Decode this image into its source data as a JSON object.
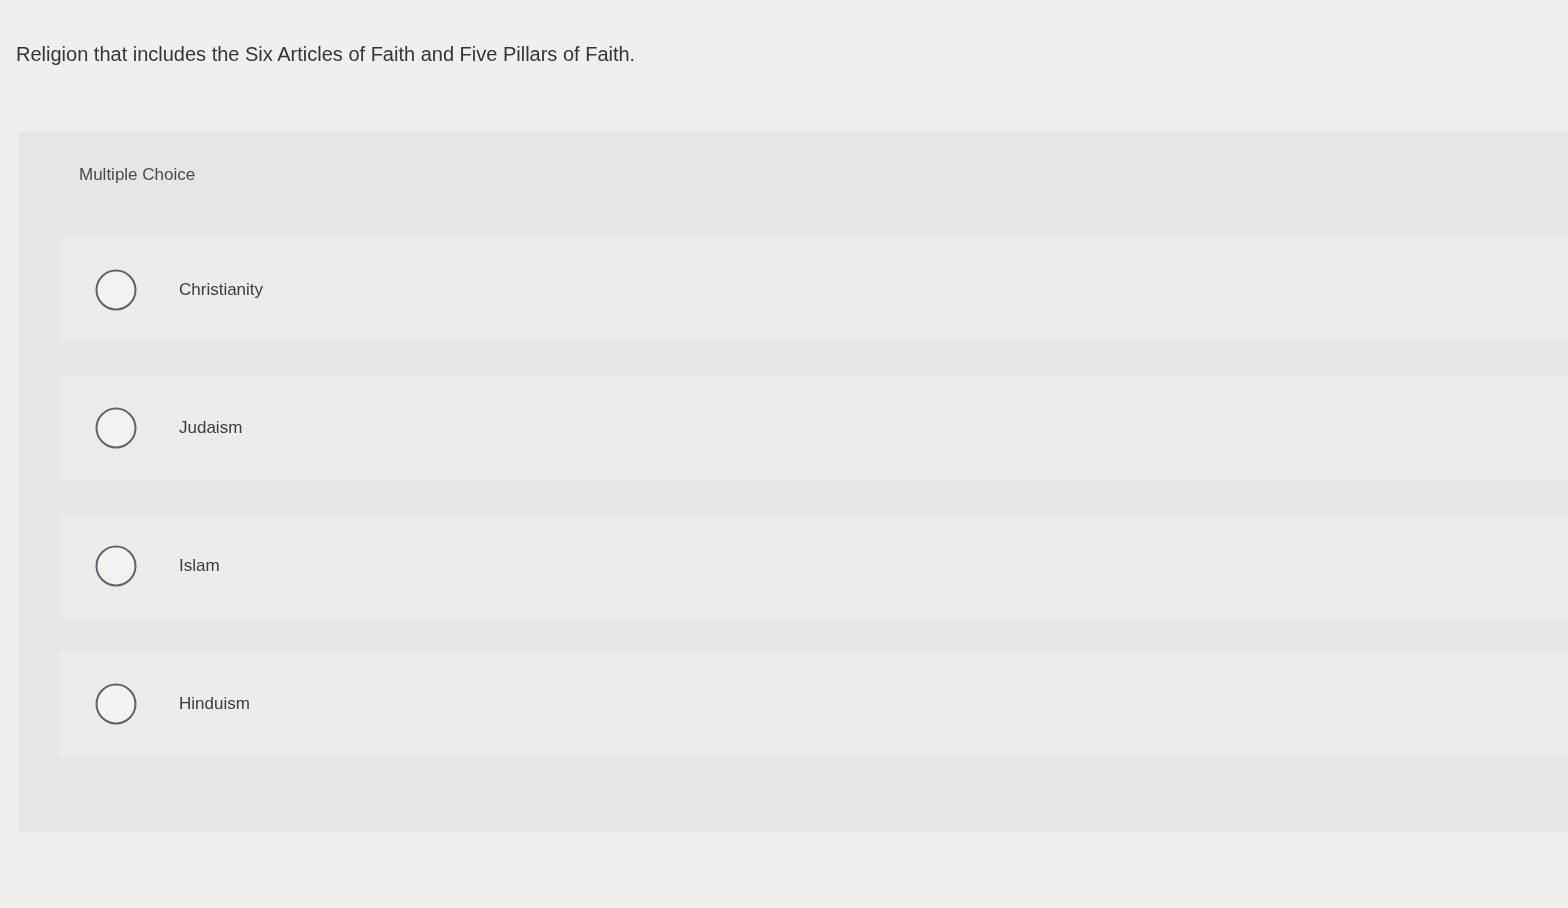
{
  "question": "Religion that includes the Six Articles of Faith and Five Pillars of Faith.",
  "answer_type": "Multiple Choice",
  "options": [
    {
      "label": "Christianity",
      "selected": false
    },
    {
      "label": "Judaism",
      "selected": false
    },
    {
      "label": "Islam",
      "selected": false
    },
    {
      "label": "Hinduism",
      "selected": false
    }
  ]
}
